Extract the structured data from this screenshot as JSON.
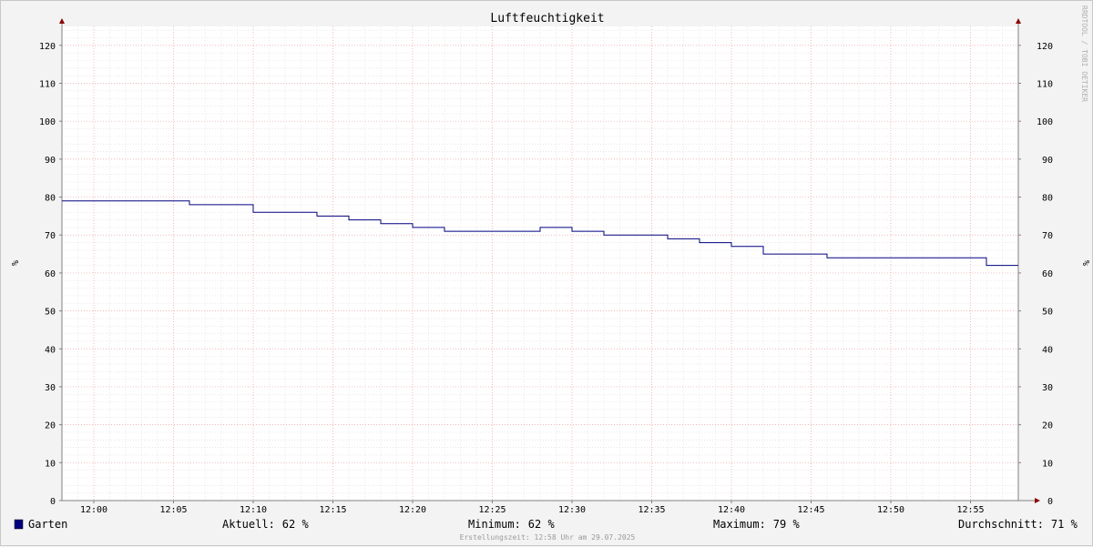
{
  "chart_data": {
    "type": "line",
    "title": "Luftfeuchtigkeit",
    "ylabel": "%",
    "ylim": [
      0,
      125
    ],
    "y_ticks": [
      0,
      10,
      20,
      30,
      40,
      50,
      60,
      70,
      80,
      90,
      100,
      110,
      120
    ],
    "x_range": [
      "11:58",
      "12:58"
    ],
    "x_ticks": [
      "12:00",
      "12:05",
      "12:10",
      "12:15",
      "12:20",
      "12:25",
      "12:30",
      "12:35",
      "12:40",
      "12:45",
      "12:50",
      "12:55"
    ],
    "grid": true,
    "series": [
      {
        "name": "Garten",
        "color": "#000080",
        "points": [
          [
            "11:58",
            79
          ],
          [
            "12:06",
            78
          ],
          [
            "12:10",
            76
          ],
          [
            "12:14",
            75
          ],
          [
            "12:16",
            74
          ],
          [
            "12:18",
            73
          ],
          [
            "12:20",
            72
          ],
          [
            "12:22",
            71
          ],
          [
            "12:28",
            72
          ],
          [
            "12:30",
            71
          ],
          [
            "12:32",
            70
          ],
          [
            "12:36",
            69
          ],
          [
            "12:38",
            68
          ],
          [
            "12:40",
            67
          ],
          [
            "12:42",
            65
          ],
          [
            "12:46",
            64
          ],
          [
            "12:56",
            62
          ],
          [
            "12:58",
            62
          ]
        ]
      }
    ],
    "legend": {
      "series_label": "Garten",
      "swatch_color": "#000080",
      "stats": [
        {
          "label": "Aktuell:",
          "value": "62 %"
        },
        {
          "label": "Minimum:",
          "value": "62 %"
        },
        {
          "label": "Maximum:",
          "value": "79 %"
        },
        {
          "label": "Durchschnitt:",
          "value": "71 %"
        }
      ]
    },
    "footer": "Erstellungszeit: 12:58 Uhr am 29.07.2025",
    "watermark": "RRDTOOL / TOBI OETIKER"
  }
}
